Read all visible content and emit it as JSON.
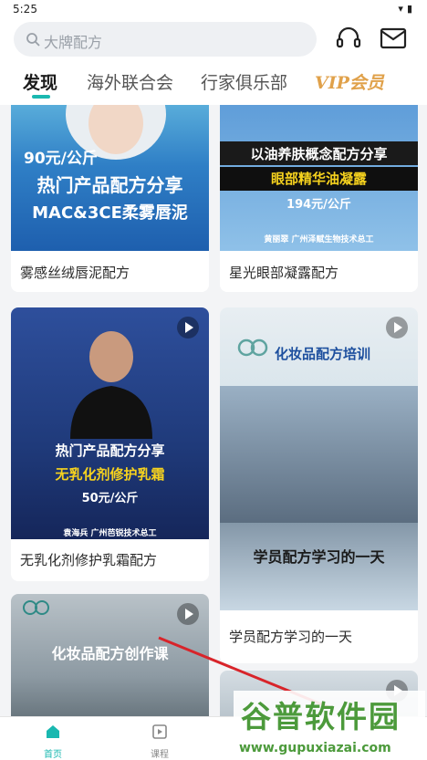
{
  "status": {
    "time": "5:25"
  },
  "search": {
    "placeholder": "大牌配方"
  },
  "tabs": [
    {
      "label": "发现"
    },
    {
      "label": "海外联合会"
    },
    {
      "label": "行家俱乐部"
    },
    {
      "label": "VIP会员"
    }
  ],
  "cards": [
    {
      "title": "雾感丝绒唇泥配方",
      "price": "90元/公斤",
      "headline": "热门产品配方分享",
      "subline": "MAC&3CE柔雾唇泥"
    },
    {
      "title": "星光眼部凝露配方",
      "headline": "以油养肤概念配方分享",
      "subline": "眼部精华油凝露",
      "price": "194元/公斤",
      "credit": "黄丽翠 广州泽赋生物技术总工"
    },
    {
      "title": "无乳化剂修护乳霜配方",
      "headline": "热门产品配方分享",
      "subline": "无乳化剂修护乳霜",
      "price": "50元/公斤",
      "credit": "袁海兵 广州芭锐技术总工"
    },
    {
      "title": "学员配方学习的一天",
      "headline": "化妆品配方培训",
      "subline": "学员配方学习的一天",
      "logo": "蛙蛙鼠"
    },
    {
      "title": "",
      "headline": "化妆品配方创作课",
      "logo": "蛙蛙鼠"
    },
    {
      "title": ""
    }
  ],
  "bottom_nav": [
    {
      "label": "首页",
      "icon": "home-icon"
    },
    {
      "label": "课程",
      "icon": "course-icon"
    }
  ],
  "watermark": {
    "title": "谷普软件园",
    "url": "www.gupuxiazai.com"
  },
  "colors": {
    "accent": "#1ab8b0",
    "vip": "#e0a14a"
  }
}
